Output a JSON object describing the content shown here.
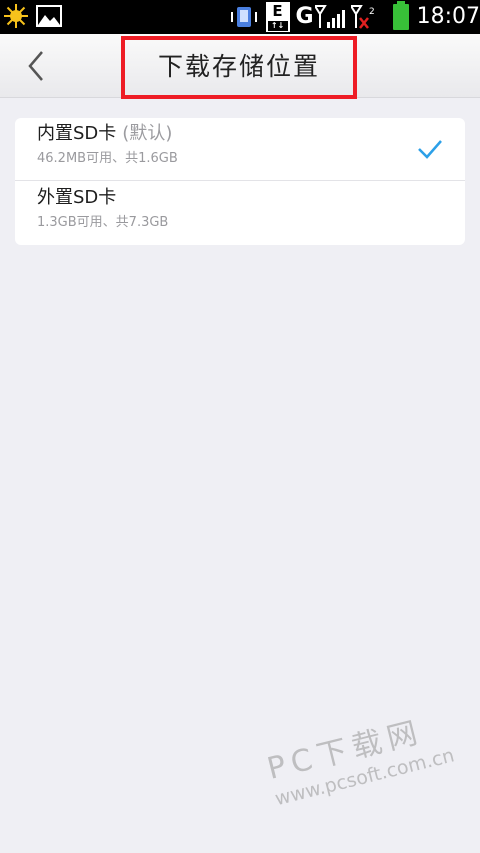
{
  "status_bar": {
    "network_type": "E",
    "network_label": "G",
    "time": "18:07"
  },
  "header": {
    "title": "下载存储位置",
    "highlight_color": "#ee1c25"
  },
  "storage_options": [
    {
      "name": "内置SD卡",
      "tag": "(默认)",
      "detail": "46.2MB可用、共1.6GB",
      "selected": true
    },
    {
      "name": "外置SD卡",
      "detail": "1.3GB可用、共7.3GB",
      "selected": false
    }
  ],
  "watermark": {
    "brand": "PC下载网",
    "url": "www.pcsoft.com.cn"
  },
  "colors": {
    "background": "#efeff4",
    "accent": "#2ca0e8",
    "battery": "#38c038"
  }
}
